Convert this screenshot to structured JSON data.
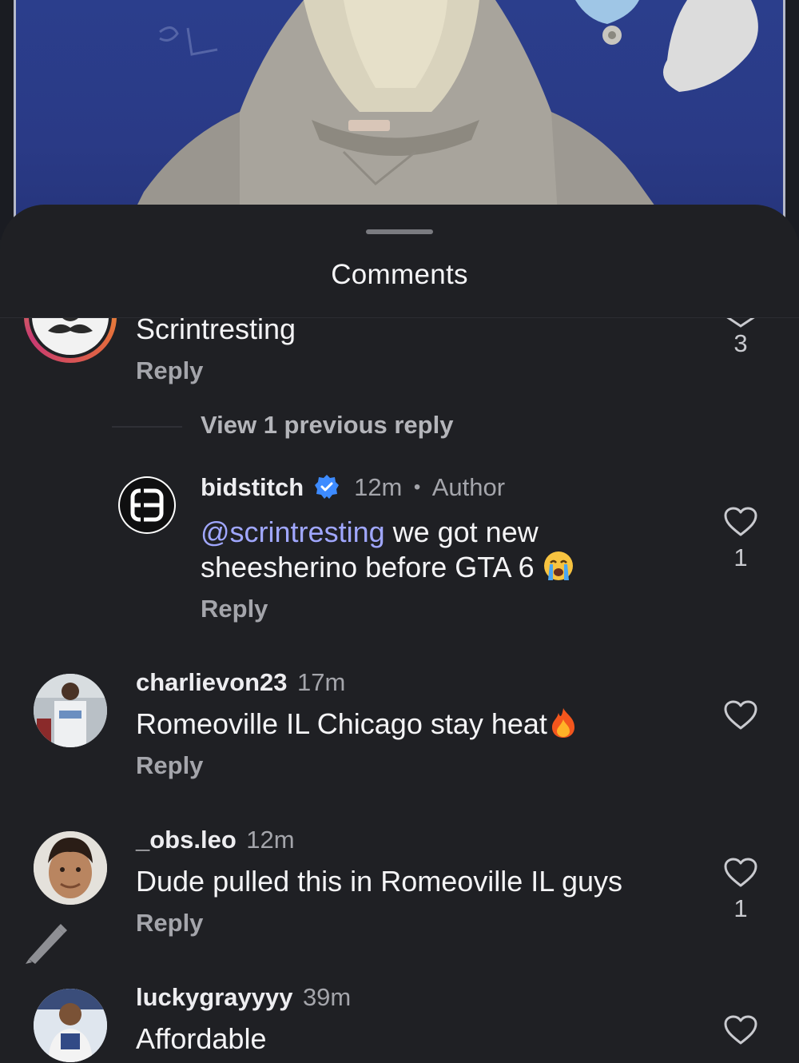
{
  "sheet": {
    "title": "Comments"
  },
  "comments": [
    {
      "text": "Scrintresting",
      "reply_label": "Reply",
      "like_count": "3"
    },
    {
      "view_previous": "View 1 previous reply",
      "username": "bidstitch",
      "time": "12m",
      "author_dot": "•",
      "author_label": "Author",
      "mention": "@scrintresting",
      "text_line1": " we got new",
      "text_line2": "sheesherino before GTA 6",
      "emoji_name": "crying-face",
      "reply_label": "Reply",
      "like_count": "1"
    },
    {
      "username": "charlievon23",
      "time": "17m",
      "text": "Romeoville IL Chicago stay heat",
      "emoji_name": "fire",
      "reply_label": "Reply"
    },
    {
      "username": "_obs.leo",
      "time": "12m",
      "text": "Dude pulled this in Romeoville IL guys",
      "reply_label": "Reply",
      "like_count": "1"
    },
    {
      "username": "luckygrayyyy",
      "time": "39m",
      "text": "Affordable"
    }
  ],
  "colors": {
    "background": "#1f2024",
    "mention": "#a0a7ff",
    "verified": "#3d8bff",
    "photo_background": "#2b3e8c"
  }
}
